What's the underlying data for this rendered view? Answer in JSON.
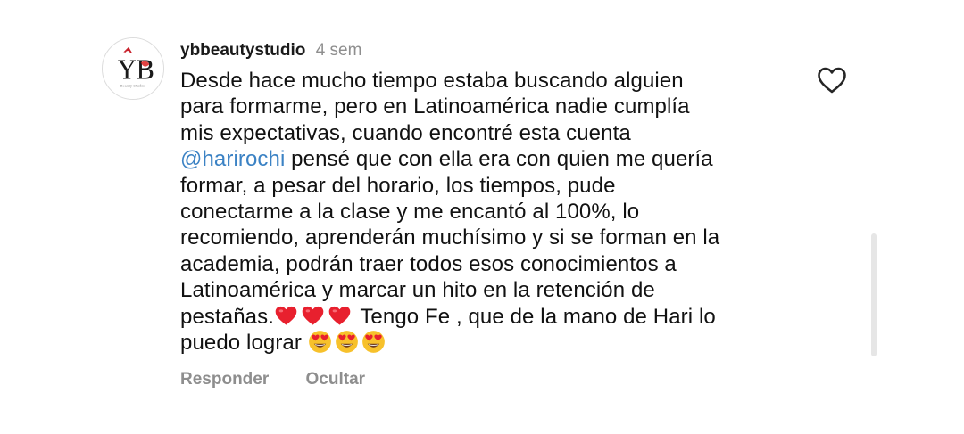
{
  "comment": {
    "username": "ybbeautystudio",
    "time": "4 sem",
    "mention": "@harirochi",
    "lines": [
      "Desde hace mucho tiempo estaba buscando alguien",
      "para formarme, pero en Latinoamérica nadie cumplía",
      "mis expectativas, cuando encontré esta cuenta",
      " pensé que con ella era con quien me quería",
      "formar, a pesar del horario, los tiempos, pude",
      "conectarme a la clase y me encantó al 100%, lo",
      "recomiendo, aprenderán muchísimo y si se forman en la",
      "academia, podrán traer todos esos conocimientos a",
      "Latinoamérica y marcar un hito en la retención de",
      "pestañas.",
      " Tengo Fe , que de la mano de Hari lo",
      "puedo lograr"
    ],
    "avatar_letters": "YB"
  },
  "actions": {
    "reply": "Responder",
    "hide": "Ocultar"
  },
  "icons": {
    "like": "heart-outline-icon",
    "emoji_heart": "red-heart-emoji",
    "emoji_eyes": "heart-eyes-emoji"
  },
  "colors": {
    "mention": "#3b82c4",
    "muted": "#8e8e8e",
    "heart_red": "#e8202e",
    "emoji_yellow": "#f7c12b"
  }
}
